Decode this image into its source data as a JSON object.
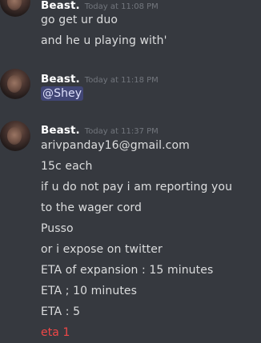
{
  "groups": [
    {
      "author": "Beast.",
      "timestamp": "Today at 11:08 PM",
      "lines": [
        "go get ur duo",
        "and he u playing with'"
      ]
    },
    {
      "author": "Beast.",
      "timestamp": "Today at 11:18 PM",
      "mention": "@Shey"
    },
    {
      "author": "Beast.",
      "timestamp": "Today at 11:37 PM",
      "lines": [
        "arivpanday16@gmail.com",
        "15c each",
        "if u do not pay i am reporting you",
        "to the wager cord",
        "Pusso",
        "or i expose on twitter",
        "ETA of expansion  : 15 minutes",
        "ETA ; 10 minutes",
        "ETA : 5",
        "eta 1"
      ]
    }
  ],
  "colors": {
    "background": "#36393f",
    "author": "#ffffff",
    "timestamp": "#72767d",
    "text": "#dcddde",
    "mention_bg": "#414675",
    "alert_text": "#f04747"
  }
}
